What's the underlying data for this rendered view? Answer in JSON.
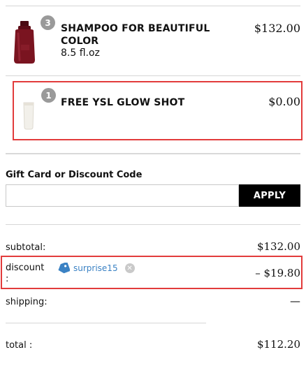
{
  "items": [
    {
      "name_line1": "SHAMPOO FOR BEAUTIFUL",
      "name_line2": "COLOR",
      "size": "8.5 fl.oz",
      "quantity": "3",
      "price": "$132.00"
    },
    {
      "name": "FREE YSL GLOW SHOT",
      "quantity": "1",
      "price": "$0.00"
    }
  ],
  "discount_form": {
    "label": "Gift Card or Discount Code",
    "input_value": "",
    "input_placeholder": "",
    "apply_label": "APPLY"
  },
  "summary": {
    "subtotal_label": "subtotal:",
    "subtotal_value": "$132.00",
    "discount_label_line1": "discount",
    "discount_label_line2": ":",
    "discount_code": "surprise15",
    "discount_value": "– $19.80",
    "shipping_label": "shipping:",
    "shipping_value": "—",
    "total_label": "total :",
    "total_value": "$112.20"
  },
  "colors": {
    "highlight": "#e23b3b",
    "tag": "#3b82c4",
    "bottle": "#7a1420",
    "apply_bg": "#000000"
  },
  "icons": {
    "product_1": "shampoo-bottle-image",
    "product_2": "tube-image",
    "tag": "price-tag-icon",
    "remove": "close-circle-icon"
  }
}
